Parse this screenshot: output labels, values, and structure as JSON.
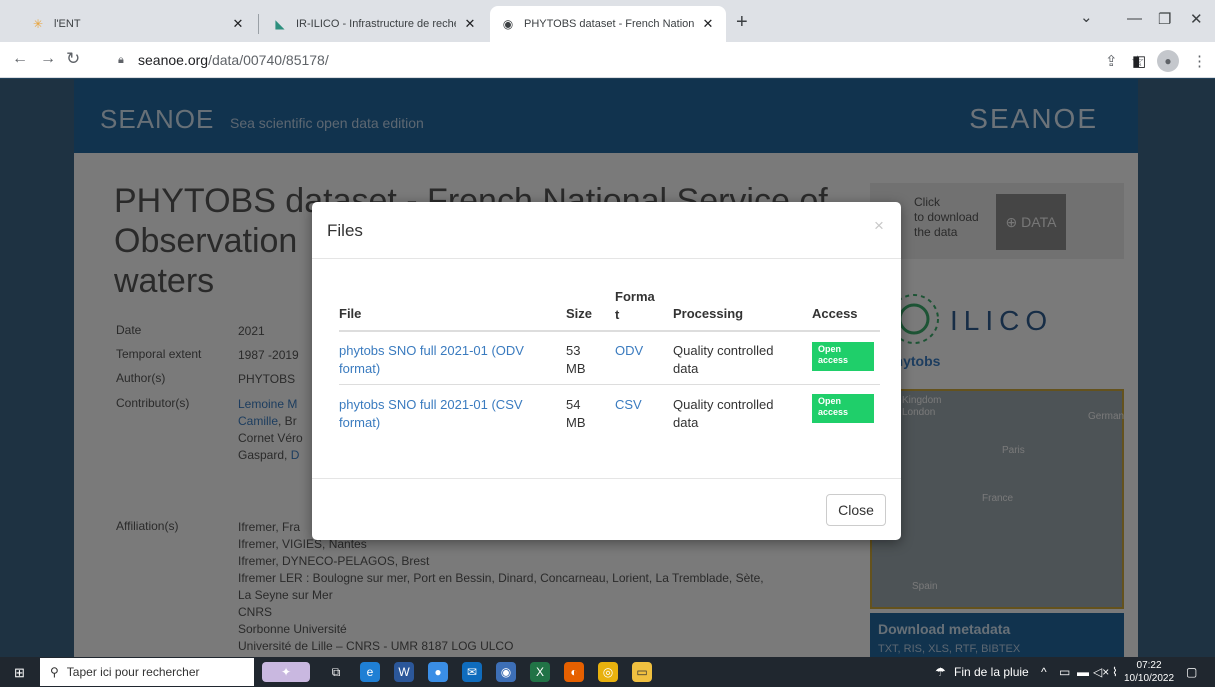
{
  "browser": {
    "tabs": [
      {
        "title": "l'ENT",
        "icon": "ent-icon"
      },
      {
        "title": "IR-ILICO - Infrastructure de recherche li",
        "icon": "ilico-icon"
      },
      {
        "title": "PHYTOBS dataset - French National Ser",
        "icon": "globe-icon",
        "active": true
      }
    ],
    "url_host": "seanoe.org",
    "url_path": "/data/00740/85178/"
  },
  "site": {
    "brand": "SEANOE",
    "tagline": "Sea scientific open data edition",
    "brand_logo": "SEANOE"
  },
  "dataset": {
    "title": "PHYTOBS dataset - French National Service of Observation ... waters",
    "title_line1": "PHYTOBS dat",
    "title_line1_tail": "aset - French National Service of",
    "title_line2": "Observation",
    "title_line3": "waters",
    "meta": {
      "date_label": "Date",
      "date": "2021",
      "temporal_label": "Temporal extent",
      "temporal": "1987 -2019",
      "author_label": "Author(s)",
      "author": "PHYTOBS",
      "contributor_label": "Contributor(s)",
      "contributor_l1": "Lemoine M",
      "contributor_l2a": "Camille",
      "contributor_l2b": ", Br",
      "contributor_l3": "Cornet Véro",
      "contributor_l4a": "Gaspard, ",
      "contributor_l4b": "D",
      "affiliation_label": "Affiliation(s)",
      "aff1": "Ifremer, Fra",
      "aff2": "Ifremer, VIGIES, Nantes",
      "aff3": "Ifremer, DYNECO-PELAGOS, Brest",
      "aff4": "Ifremer LER : Boulogne sur mer, Port en Bessin, Dinard, Concarneau, Lorient, La Tremblade, Sète,",
      "aff5": "La Seyne sur Mer",
      "aff6": "CNRS",
      "aff7": "Sorbonne Université",
      "aff8": "Université de Lille – CNRS - UMR 8187 LOG ULCO"
    }
  },
  "sidebar": {
    "click_text_1": "Click",
    "click_text_2": "to download",
    "click_text_3": "the data",
    "data_button": "⊕ DATA",
    "logo_ilico": "ILICO",
    "logo_phytobs": "phytobs",
    "map_labels": [
      "Kingdom",
      "London",
      "German",
      "Paris",
      "France",
      "Spain"
    ],
    "download_metadata_title": "Download metadata",
    "download_metadata_formats": "TXT, RIS, XLS, RTF, BIBTEX"
  },
  "modal": {
    "title": "Files",
    "close_x": "×",
    "headers": {
      "file": "File",
      "size": "Size",
      "format_l1": "Forma",
      "format_l2": "t",
      "processing": "Processing",
      "access": "Access"
    },
    "rows": [
      {
        "file_l1": "phytobs SNO full 2021-01 (ODV",
        "file_l2": "format)",
        "size_l1": "53",
        "size_l2": "MB",
        "format": "ODV",
        "processing_l1": "Quality controlled",
        "processing_l2": "data",
        "access_l1": "Open",
        "access_l2": "access"
      },
      {
        "file_l1": "phytobs SNO full 2021-01 (CSV",
        "file_l2": "format)",
        "size_l1": "54",
        "size_l2": "MB",
        "format": "CSV",
        "processing_l1": "Quality controlled",
        "processing_l2": "data",
        "access_l1": "Open",
        "access_l2": "access"
      }
    ],
    "close_button": "Close"
  },
  "taskbar": {
    "search_placeholder": "Taper ici pour rechercher",
    "weather": "Fin de la pluie",
    "time": "07:22",
    "date": "10/10/2022"
  },
  "colors": {
    "link": "#3a7bbf",
    "header_blue": "#23669d",
    "open_access_green": "#1fcf6a"
  }
}
